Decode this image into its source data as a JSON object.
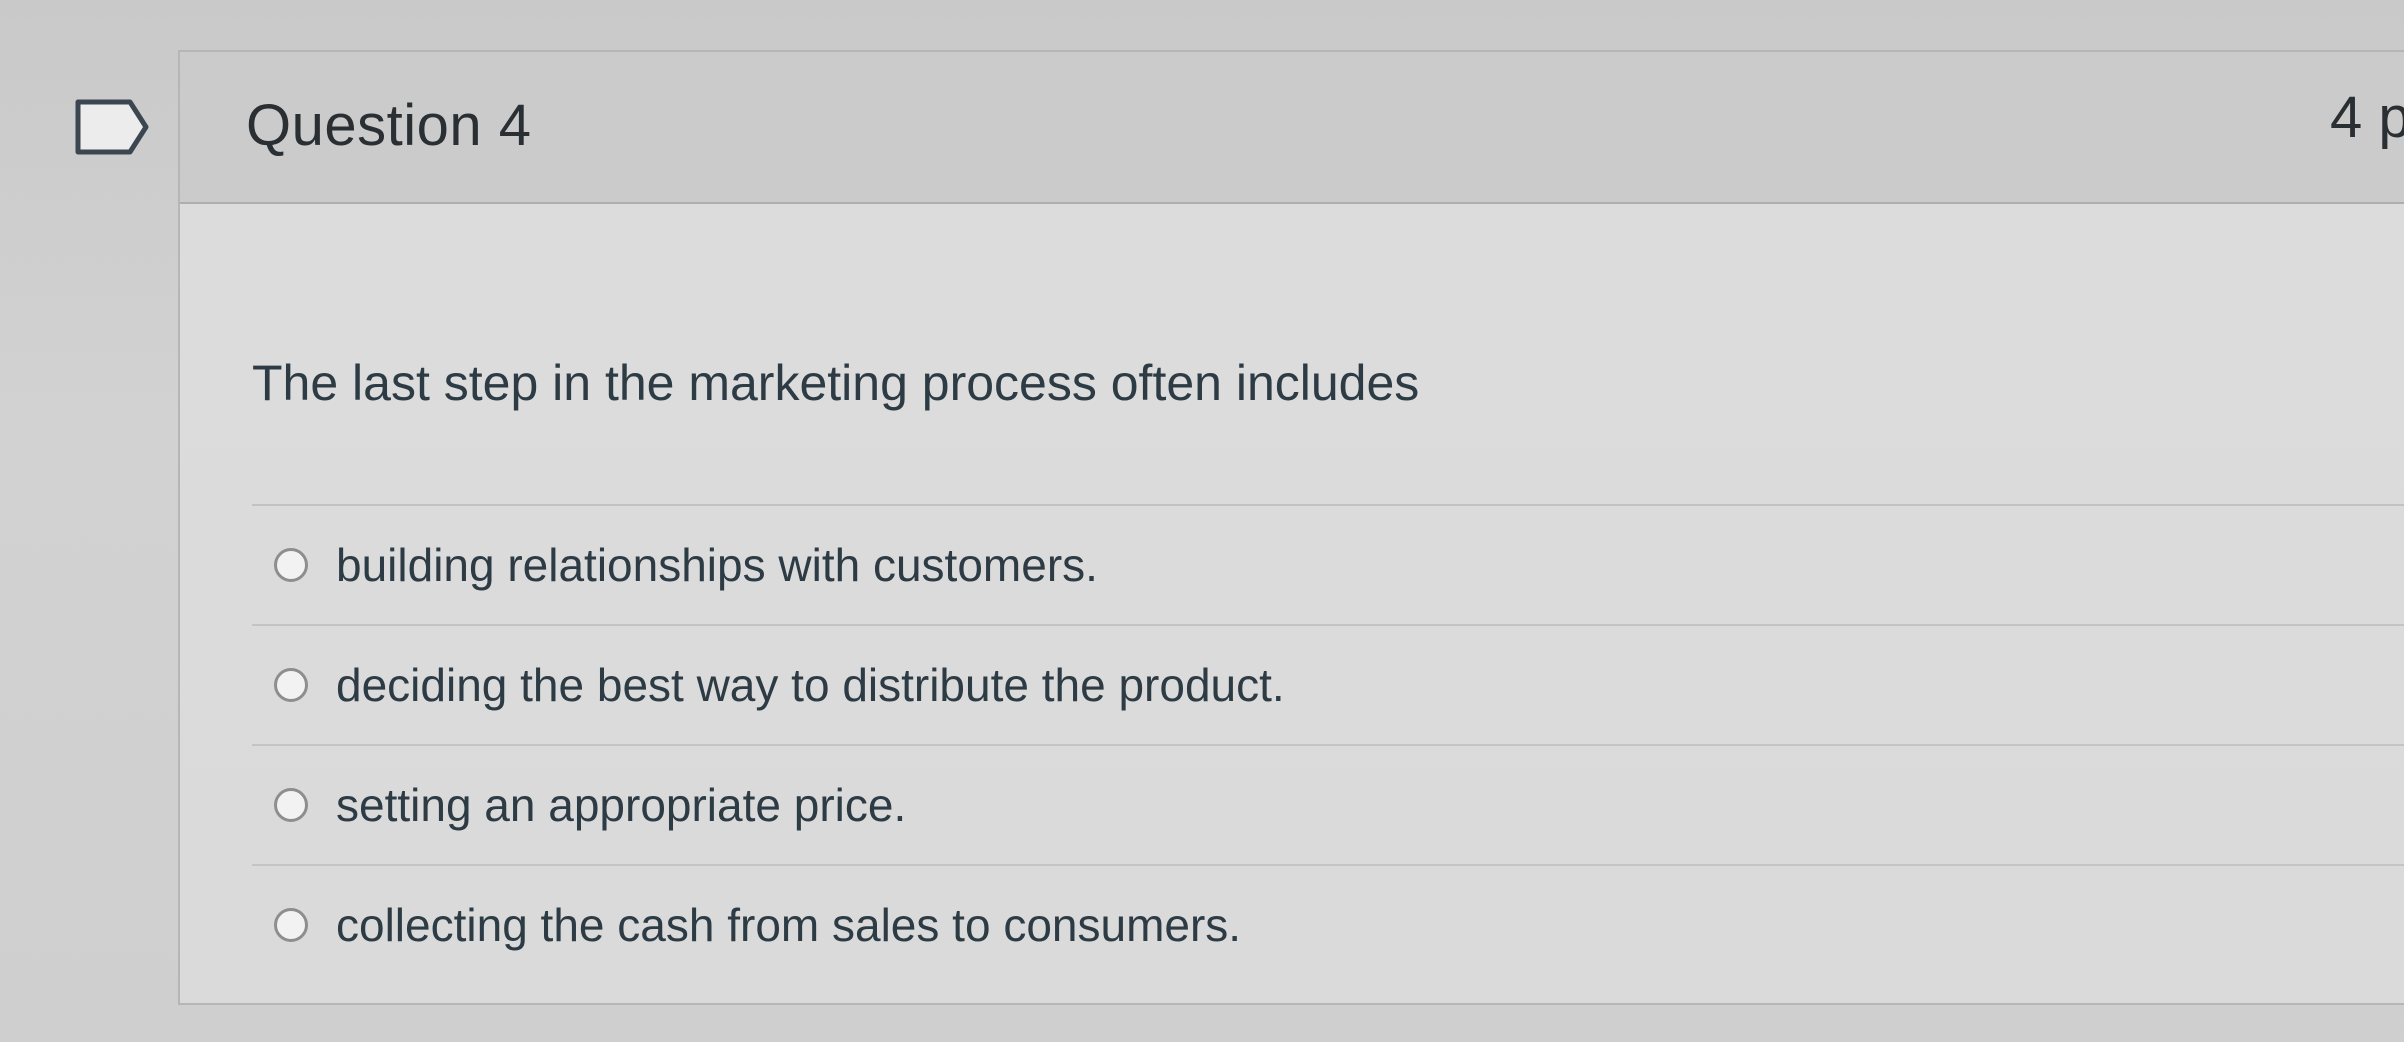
{
  "question": {
    "title": "Question 4",
    "points": "4 p",
    "text": "The last step in the marketing process often includes",
    "answers": [
      {
        "label": "building relationships with customers."
      },
      {
        "label": "deciding the best way to distribute the product."
      },
      {
        "label": "setting an appropriate price."
      },
      {
        "label": "collecting the cash from sales to consumers."
      }
    ]
  },
  "icons": {
    "flag": "flag-question-icon"
  }
}
